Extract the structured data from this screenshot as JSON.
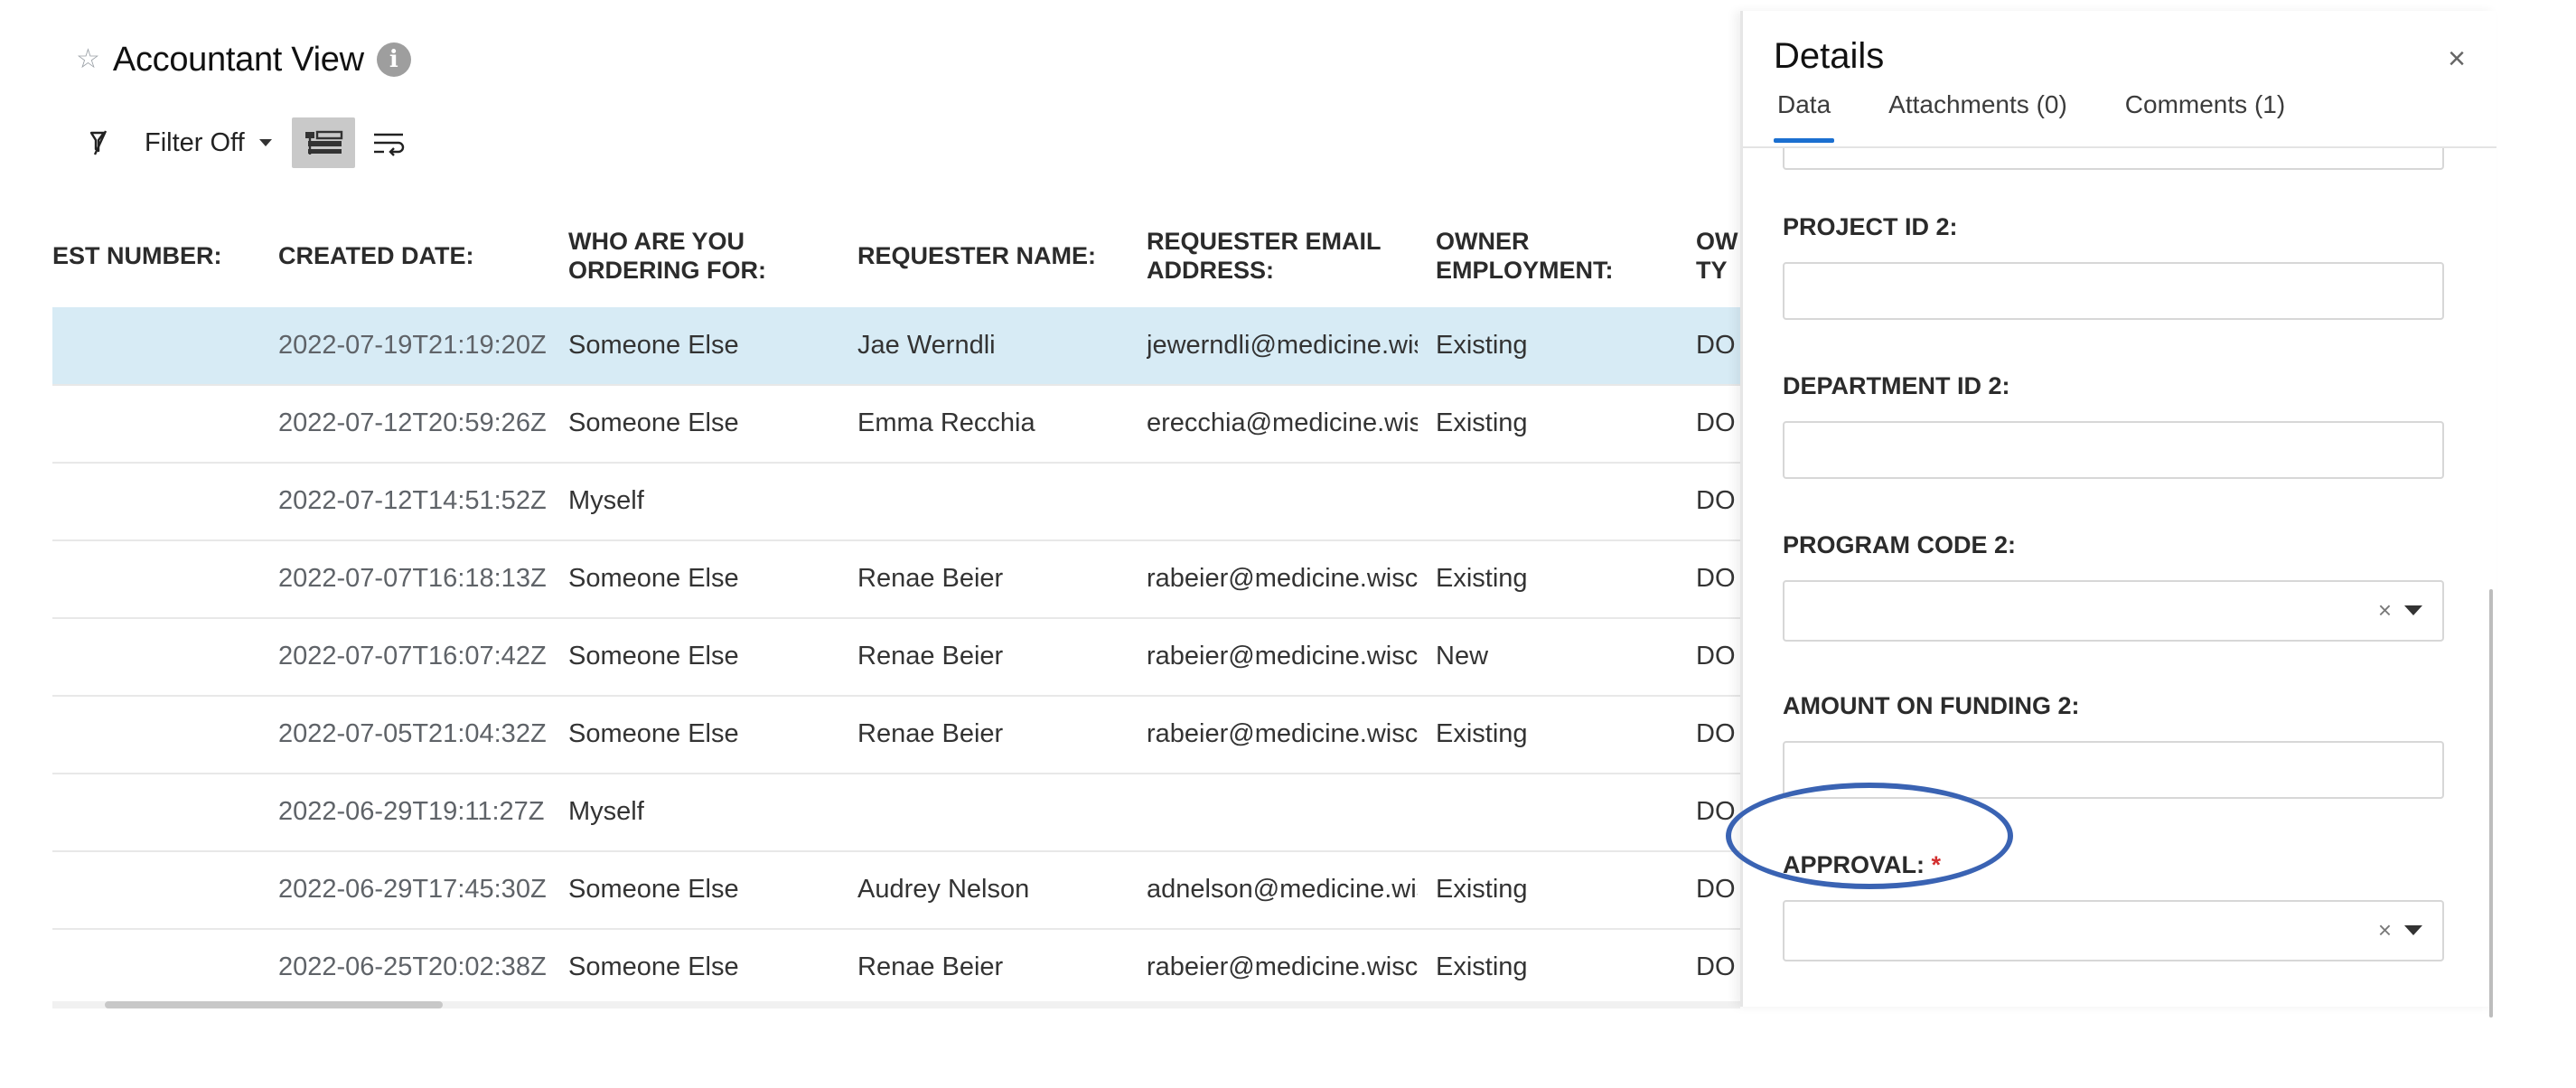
{
  "header": {
    "title": "Accountant View",
    "star_icon": "star-outline-icon",
    "info_icon": "info-icon",
    "info_glyph": "i"
  },
  "toolbar": {
    "clear_filter_icon": "filter-off-icon",
    "filter_label": "Filter Off",
    "view_icon": "grid-view-icon",
    "wrap_icon": "text-wrap-icon"
  },
  "grid": {
    "columns": [
      [
        "EST NUMBER:"
      ],
      [
        "CREATED DATE:"
      ],
      [
        "WHO ARE YOU",
        "ORDERING FOR:"
      ],
      [
        "REQUESTER NAME:"
      ],
      [
        "REQUESTER EMAIL",
        "ADDRESS:"
      ],
      [
        "OWNER",
        "EMPLOYMENT:"
      ],
      [
        "OW",
        "TY"
      ]
    ],
    "rows": [
      [
        "",
        "2022-07-19T21:19:20Z",
        "Someone Else",
        "Jae Werndli",
        "jewerndli@medicine.wis",
        "Existing",
        "DO"
      ],
      [
        "",
        "2022-07-12T20:59:26Z",
        "Someone Else",
        "Emma Recchia",
        "erecchia@medicine.wisc",
        "Existing",
        "DO"
      ],
      [
        "",
        "2022-07-12T14:51:52Z",
        "Myself",
        "",
        "",
        "",
        "DO"
      ],
      [
        "",
        "2022-07-07T16:18:13Z",
        "Someone Else",
        "Renae Beier",
        "rabeier@medicine.wisc.e",
        "Existing",
        "DO"
      ],
      [
        "",
        "2022-07-07T16:07:42Z",
        "Someone Else",
        "Renae Beier",
        "rabeier@medicine.wisc.e",
        "New",
        "DO"
      ],
      [
        "",
        "2022-07-05T21:04:32Z",
        "Someone Else",
        "Renae Beier",
        "rabeier@medicine.wisc.e",
        "Existing",
        "DO"
      ],
      [
        "",
        "2022-06-29T19:11:27Z",
        "Myself",
        "",
        "",
        "",
        "DO"
      ],
      [
        "",
        "2022-06-29T17:45:30Z",
        "Someone Else",
        "Audrey Nelson",
        "adnelson@medicine.wis",
        "Existing",
        "DO"
      ],
      [
        "",
        "2022-06-25T20:02:38Z",
        "Someone Else",
        "Renae Beier",
        "rabeier@medicine.wisc.e",
        "Existing",
        "DO"
      ]
    ],
    "selected_row": 0
  },
  "details": {
    "title": "Details",
    "close_glyph": "×",
    "tabs": [
      "Data",
      "Attachments (0)",
      "Comments (1)"
    ],
    "active_tab": 0,
    "fields": {
      "project_id_2": {
        "label": "PROJECT ID 2:",
        "value": ""
      },
      "department_id_2": {
        "label": "DEPARTMENT ID 2:",
        "value": ""
      },
      "program_code_2": {
        "label": "PROGRAM CODE 2:",
        "value": ""
      },
      "amount_on_funding_2": {
        "label": "AMOUNT ON FUNDING 2:",
        "value": ""
      },
      "approval": {
        "label": "APPROVAL:",
        "required_mark": "*",
        "value": ""
      }
    },
    "clear_glyph": "×"
  },
  "colors": {
    "selected_row": "#d7ebf5",
    "active_tab_underline": "#1b6fd0",
    "annotation_ellipse": "#3a63b3",
    "required": "#d32f2f"
  }
}
